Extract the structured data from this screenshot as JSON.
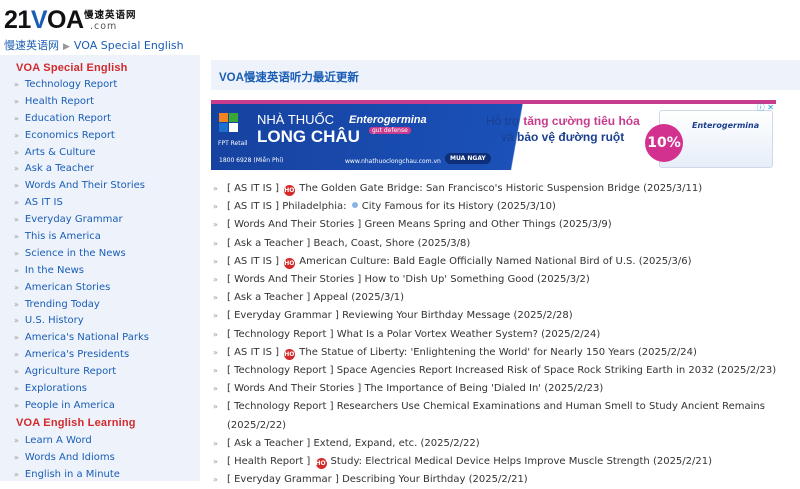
{
  "header": {
    "logo_text_1": "21",
    "logo_text_2": "V",
    "logo_text_3": "OA",
    "logo_cn": "慢速英语网",
    "logo_domain": ".com"
  },
  "breadcrumb": {
    "home": "慢速英语网",
    "current": "VOA Special English"
  },
  "sidebar": {
    "groups": [
      {
        "title": "VOA Special English",
        "items": [
          "Technology Report",
          "Health Report",
          "Education Report",
          "Economics Report",
          "Arts & Culture",
          "Ask a Teacher",
          "Words And Their Stories",
          "AS IT IS",
          "Everyday Grammar",
          "This is America",
          "Science in the News",
          "In the News",
          "American Stories",
          "Trending Today",
          "U.S. History",
          "America's National Parks",
          "America's Presidents",
          "Agriculture Report",
          "Explorations",
          "People in America"
        ]
      },
      {
        "title": "VOA English Learning",
        "items": [
          "Learn A Word",
          "Words And Idioms",
          "English in a Minute"
        ]
      }
    ]
  },
  "main": {
    "title": "VOA慢速英语听力最近更新",
    "ad": {
      "fpt": "FPT Retail",
      "pharmacy_line1": "NHÀ THUỐC",
      "pharmacy_line2": "LONG CHÂU",
      "brand": "Enterogermina",
      "brand_sub": "gut defense",
      "phone": "1800 6928 (Miễn Phí)",
      "web": "www.nhathuoclongchau.com.vn",
      "buy": "MUA NGAY",
      "headline1_prefix": "Hỗ trợ ",
      "headline1_em": "tăng cường tiêu hóa",
      "headline2_prefix": "và ",
      "headline2_em": "bảo vệ đường ruột",
      "badge": "10%",
      "product": "Enterogermina",
      "adchoices": "ⓘ ✕"
    },
    "articles": [
      {
        "cat": "[ AS IT IS ]",
        "hot": true,
        "title": "The Golden Gate Bridge: San Francisco's Historic Suspension Bridge",
        "date": "(2025/3/11)"
      },
      {
        "cat": "[ AS IT IS ]",
        "hot": false,
        "title": "Philadelphia:",
        "title2": "City Famous for its History",
        "date": "(2025/3/10)",
        "dot": true
      },
      {
        "cat": "[ Words And Their Stories ]",
        "hot": false,
        "title": "Green Means Spring and Other Things",
        "date": "(2025/3/9)"
      },
      {
        "cat": "[ Ask a Teacher ]",
        "hot": false,
        "title": "Beach, Coast, Shore",
        "date": "(2025/3/8)"
      },
      {
        "cat": "[ AS IT IS ]",
        "hot": true,
        "title": "American Culture: Bald Eagle Officially Named National Bird of U.S.",
        "date": "(2025/3/6)"
      },
      {
        "cat": "[ Words And Their Stories ]",
        "hot": false,
        "title": "How to 'Dish Up' Something Good",
        "date": "(2025/3/2)"
      },
      {
        "cat": "[ Ask a Teacher ]",
        "hot": false,
        "title": "Appeal",
        "date": "(2025/3/1)"
      },
      {
        "cat": "[ Everyday Grammar ]",
        "hot": false,
        "title": "Reviewing Your Birthday Message",
        "date": "(2025/2/28)"
      },
      {
        "cat": "[ Technology Report ]",
        "hot": false,
        "title": "What Is a Polar Vortex Weather System?",
        "date": "(2025/2/24)"
      },
      {
        "cat": "[ AS IT IS ]",
        "hot": true,
        "title": "The Statue of Liberty: 'Enlightening the World' for Nearly 150 Years",
        "date": "(2025/2/24)"
      },
      {
        "cat": "[ Technology Report ]",
        "hot": false,
        "title": "Space Agencies Report Increased Risk of Space Rock Striking Earth in 2032",
        "date": "(2025/2/23)"
      },
      {
        "cat": "[ Words And Their Stories ]",
        "hot": false,
        "title": "The Importance of Being 'Dialed In'",
        "date": "(2025/2/23)"
      },
      {
        "cat": "[ Technology Report ]",
        "hot": false,
        "title": "Researchers Use Chemical Examinations and Human Smell to Study Ancient Remains",
        "date": "(2025/2/22)",
        "wrap": true
      },
      {
        "cat": "[ Ask a Teacher ]",
        "hot": false,
        "title": "Extend, Expand, etc.",
        "date": "(2025/2/22)"
      },
      {
        "cat": "[ Health Report ]",
        "hot": true,
        "title": "Study: Electrical Medical Device Helps Improve Muscle Strength",
        "date": "(2025/2/21)"
      },
      {
        "cat": "[ Everyday Grammar ]",
        "hot": false,
        "title": "Describing Your Birthday",
        "date": "(2025/2/21)"
      }
    ],
    "hot_label": "HOT"
  }
}
